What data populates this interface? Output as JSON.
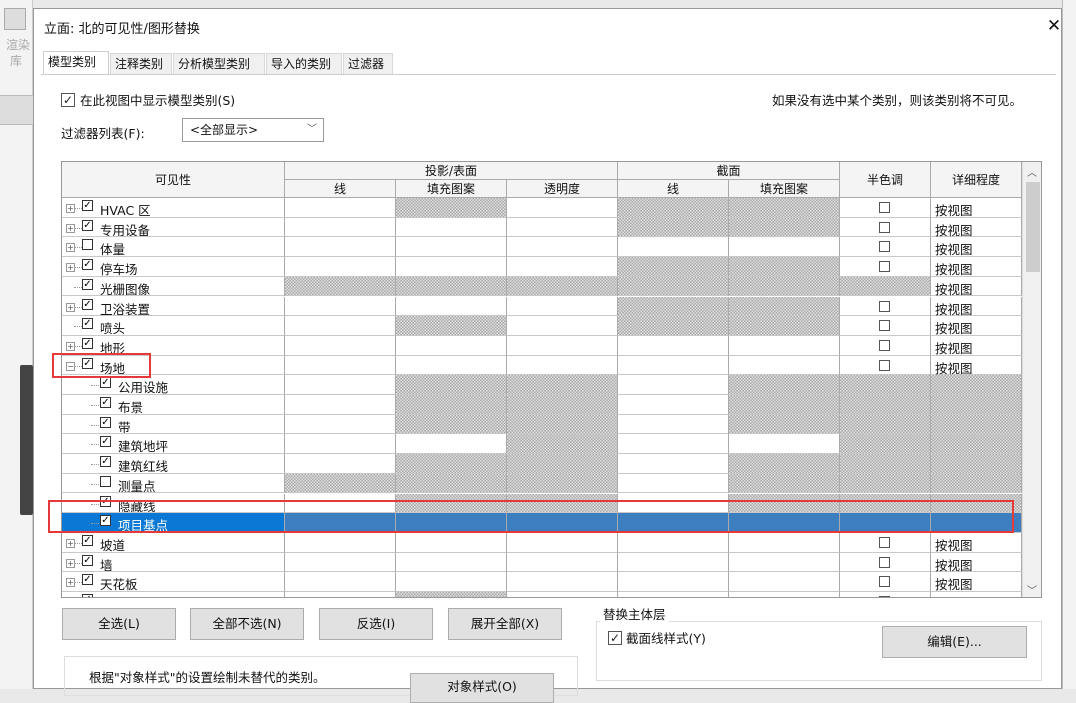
{
  "app": {
    "ribbon_label_1": "渲染",
    "ribbon_label_2": "库"
  },
  "dialog": {
    "title": "立面: 北的可见性/图形替换",
    "tabs": [
      {
        "label": "模型类别",
        "active": true
      },
      {
        "label": "注释类别"
      },
      {
        "label": "分析模型类别"
      },
      {
        "label": "导入的类别"
      },
      {
        "label": "过滤器"
      }
    ],
    "show_categories": {
      "label": "在此视图中显示模型类别(S)",
      "checked": true
    },
    "hint": "如果没有选中某个类别，则该类别将不可见。",
    "filter_list": {
      "label": "过滤器列表(F):",
      "value": "<全部显示>"
    },
    "table": {
      "headers": {
        "visibility": "可见性",
        "projection": "投影/表面",
        "proj_line": "线",
        "proj_fill": "填充图案",
        "proj_trans": "透明度",
        "cut": "截面",
        "cut_line": "线",
        "cut_fill": "填充图案",
        "halftone": "半色调",
        "detail": "详细程度"
      },
      "rows": [
        {
          "name": "HVAC 区",
          "level": 0,
          "expander": "+",
          "checked": true,
          "hatch": [
            0,
            1,
            0,
            1,
            1,
            0,
            0
          ],
          "halftone_box": true,
          "detail": "按视图"
        },
        {
          "name": "专用设备",
          "level": 0,
          "expander": "+",
          "checked": true,
          "hatch": [
            0,
            0,
            0,
            1,
            1,
            0,
            0
          ],
          "halftone_box": true,
          "detail": "按视图"
        },
        {
          "name": "体量",
          "level": 0,
          "expander": "+",
          "checked": false,
          "hatch": [
            0,
            0,
            0,
            0,
            0,
            0,
            0
          ],
          "halftone_box": true,
          "detail": "按视图"
        },
        {
          "name": "停车场",
          "level": 0,
          "expander": "+",
          "checked": true,
          "hatch": [
            0,
            0,
            0,
            1,
            1,
            0,
            0
          ],
          "halftone_box": true,
          "detail": "按视图"
        },
        {
          "name": "光栅图像",
          "level": 0,
          "expander": "",
          "checked": true,
          "hatch": [
            1,
            1,
            1,
            1,
            1,
            1,
            0
          ],
          "halftone_box": false,
          "detail": "按视图"
        },
        {
          "name": "卫浴装置",
          "level": 0,
          "expander": "+",
          "checked": true,
          "hatch": [
            0,
            0,
            0,
            1,
            1,
            0,
            0
          ],
          "halftone_box": true,
          "detail": "按视图"
        },
        {
          "name": "喷头",
          "level": 0,
          "expander": "",
          "checked": true,
          "hatch": [
            0,
            1,
            0,
            1,
            1,
            0,
            0
          ],
          "halftone_box": true,
          "detail": "按视图"
        },
        {
          "name": "地形",
          "level": 0,
          "expander": "+",
          "checked": true,
          "hatch": [
            0,
            0,
            0,
            0,
            0,
            0,
            0
          ],
          "halftone_box": true,
          "detail": "按视图"
        },
        {
          "name": "场地",
          "level": 0,
          "expander": "-",
          "checked": true,
          "hatch": [
            0,
            0,
            0,
            0,
            0,
            0,
            0
          ],
          "halftone_box": true,
          "detail": "按视图"
        },
        {
          "name": "公用设施",
          "level": 1,
          "checked": true,
          "hatch": [
            0,
            1,
            1,
            0,
            1,
            1,
            1
          ],
          "halftone_box": false,
          "detail": ""
        },
        {
          "name": "布景",
          "level": 1,
          "checked": true,
          "hatch": [
            0,
            1,
            1,
            0,
            1,
            1,
            1
          ],
          "halftone_box": false,
          "detail": ""
        },
        {
          "name": "带",
          "level": 1,
          "checked": true,
          "hatch": [
            0,
            1,
            1,
            0,
            1,
            1,
            1
          ],
          "halftone_box": false,
          "detail": ""
        },
        {
          "name": "建筑地坪",
          "level": 1,
          "checked": true,
          "hatch": [
            0,
            0,
            1,
            0,
            0,
            1,
            1
          ],
          "halftone_box": false,
          "detail": ""
        },
        {
          "name": "建筑红线",
          "level": 1,
          "checked": true,
          "hatch": [
            0,
            1,
            1,
            0,
            1,
            1,
            1
          ],
          "halftone_box": false,
          "detail": ""
        },
        {
          "name": "测量点",
          "level": 1,
          "checked": false,
          "hatch": [
            1,
            1,
            1,
            0,
            1,
            1,
            1
          ],
          "halftone_box": false,
          "detail": ""
        },
        {
          "name": "隐藏线",
          "level": 1,
          "checked": true,
          "hatch": [
            0,
            1,
            1,
            0,
            1,
            1,
            1
          ],
          "halftone_box": false,
          "detail": ""
        },
        {
          "name": "项目基点",
          "level": 1,
          "checked": true,
          "selected": true,
          "hatch": [
            1,
            1,
            1,
            1,
            1,
            1,
            1
          ],
          "halftone_box": false,
          "detail": ""
        },
        {
          "name": "坡道",
          "level": 0,
          "expander": "+",
          "checked": true,
          "hatch": [
            0,
            0,
            0,
            0,
            0,
            0,
            0
          ],
          "halftone_box": true,
          "detail": "按视图"
        },
        {
          "name": "墙",
          "level": 0,
          "expander": "+",
          "checked": true,
          "hatch": [
            0,
            0,
            0,
            0,
            0,
            0,
            0
          ],
          "halftone_box": true,
          "detail": "按视图"
        },
        {
          "name": "天花板",
          "level": 0,
          "expander": "+",
          "checked": true,
          "hatch": [
            0,
            0,
            0,
            0,
            0,
            0,
            0
          ],
          "halftone_box": true,
          "detail": "按视图"
        },
        {
          "name": "",
          "level": 0,
          "expander": "+",
          "checked": true,
          "hatch": [
            0,
            1,
            0,
            0,
            0,
            0,
            0
          ],
          "halftone_box": true,
          "detail": ""
        }
      ]
    },
    "buttons": {
      "select_all": "全选(L)",
      "select_none": "全部不选(N)",
      "invert": "反选(I)",
      "expand_all": "展开全部(X)",
      "edit": "编辑(E)...",
      "object_styles": "对象样式(O)"
    },
    "host_layers": {
      "title": "替换主体层",
      "cut_line_styles": {
        "label": "截面线样式(Y)",
        "checked": true
      }
    },
    "note": "根据\"对象样式\"的设置绘制未替代的类别。",
    "colors": {
      "selection": "#0a78d4",
      "highlight_box": "#e8393a"
    }
  }
}
